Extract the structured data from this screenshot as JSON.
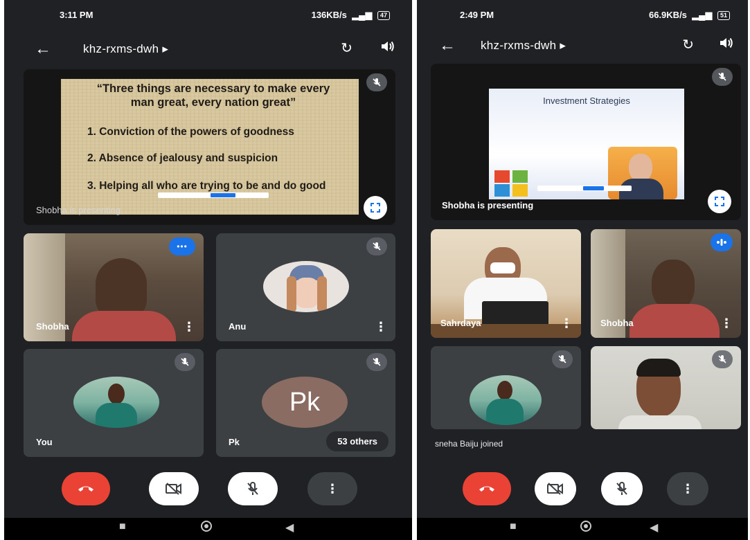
{
  "left": {
    "status": {
      "time": "3:11 PM",
      "net_speed": "136KB/s",
      "battery": "47"
    },
    "meeting": {
      "code": "khz-rxms-dwh"
    },
    "presentation": {
      "label": "Shobha is presenting",
      "slide_title": "“Three things are necessary to make every man great, every nation great”",
      "slide_items": [
        "1. Conviction of the powers of goodness",
        "2. Absence of jealousy and suspicion",
        "3. Helping all who are trying to be and do good"
      ]
    },
    "tiles": [
      {
        "name": "Shobha"
      },
      {
        "name": "Anu"
      },
      {
        "name": "You"
      },
      {
        "name": "Pk",
        "initials": "Pk",
        "others": "53 others"
      }
    ]
  },
  "right": {
    "status": {
      "time": "2:49 PM",
      "net_speed": "66.9KB/s",
      "battery": "51"
    },
    "meeting": {
      "code": "khz-rxms-dwh"
    },
    "presentation": {
      "label": "Shobha is presenting",
      "slide_title": "Investment Strategies"
    },
    "tiles": [
      {
        "name": "Sahrdaya"
      },
      {
        "name": "Shobha"
      },
      {
        "name": ""
      },
      {
        "name": ""
      }
    ],
    "toast": "sneha Baiju joined"
  },
  "icons": {
    "back": "←",
    "play": "▸",
    "camera_switch": "↻",
    "speaker": "🔈",
    "mic_off": "∕",
    "more_vert": "⋮",
    "more_horiz": "•••",
    "fullscreen": "⛶",
    "end_call": "☎",
    "video_off": "▭",
    "nav_square": "■",
    "nav_circle": "●",
    "nav_back": "◀"
  },
  "colors": {
    "background": "#202124",
    "tile": "#3c4043",
    "end_call": "#ea4335",
    "accent_blue": "#1a73e8"
  }
}
